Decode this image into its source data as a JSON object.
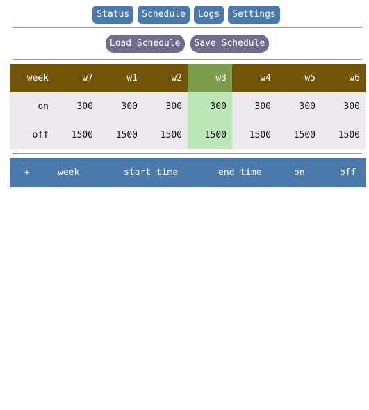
{
  "nav": {
    "status_label": "Status",
    "schedule_label": "Schedule",
    "logs_label": "Logs",
    "settings_label": "Settings"
  },
  "actions": {
    "load_label": "Load Schedule",
    "save_label": "Save Schedule"
  },
  "schedule_table": {
    "header": [
      "week",
      "w7",
      "w1",
      "w2",
      "w3",
      "w4",
      "w5",
      "w6"
    ],
    "selected_column": "w3",
    "rows": [
      {
        "label": "on",
        "values": [
          "300",
          "300",
          "300",
          "300",
          "300",
          "300",
          "300"
        ]
      },
      {
        "label": "off",
        "values": [
          "1500",
          "1500",
          "1500",
          "1500",
          "1500",
          "1500",
          "1500"
        ]
      }
    ]
  },
  "entries_header": {
    "add": "+",
    "week": "week",
    "start_time": "start time",
    "end_time": "end time",
    "on": "on",
    "off": "off"
  },
  "colors": {
    "nav_button": "#4a7aab",
    "file_button": "#6f6d8c",
    "table_header": "#725409",
    "selected_header": "#7c9e4c",
    "selected_cell": "#bce8b8",
    "cell_background": "#edeaef",
    "entries_header": "#4a7aab"
  }
}
